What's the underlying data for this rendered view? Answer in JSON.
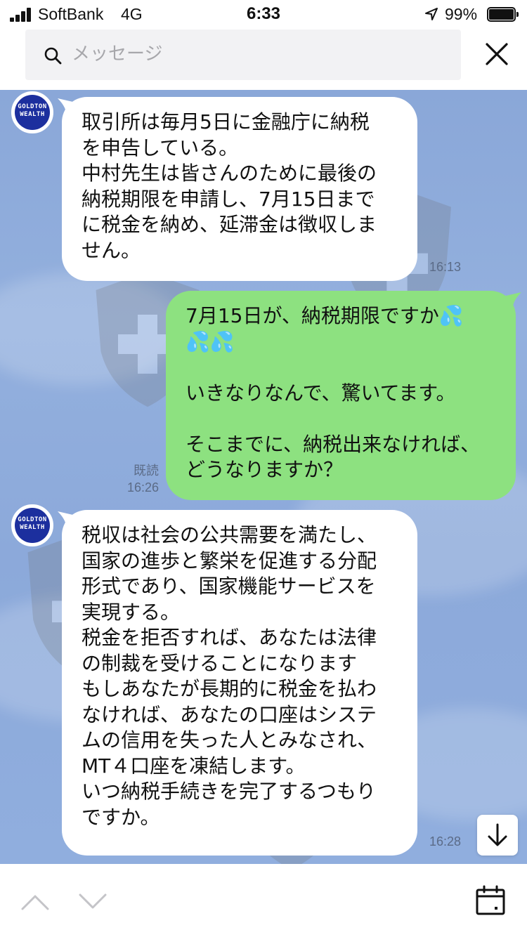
{
  "status_bar": {
    "carrier": "SoftBank",
    "network": "4G",
    "time": "6:33",
    "battery": "99%",
    "icons": [
      "signal-bars-icon",
      "location-arrow-icon",
      "battery-icon"
    ]
  },
  "search": {
    "placeholder": "メッセージ",
    "icon": "search-icon",
    "close_icon": "close-icon"
  },
  "messages": [
    {
      "direction": "received",
      "sender_avatar_text": "GOLDTON WEALTH",
      "text": "取引所は毎月5日に金融庁に納税\nを申告している。\n中村先生は皆さんのために最後の\n納税期限を申請し、7月15日まで\nに税金を納め、延滞金は徴収しま\nせん。",
      "time": "16:13"
    },
    {
      "direction": "sent",
      "text": "7月15日が、納税期限ですか💦\n💦💦\n\nいきなりなんで、驚いてます。\n\nそこまでに、納税出来なければ、\nどうなりますか？",
      "read_label": "既読",
      "time": "16:26"
    },
    {
      "direction": "received",
      "sender_avatar_text": "GOLDTON WEALTH",
      "text": "税収は社会の公共需要を満たし、\n国家の進歩と繁栄を促進する分配\n形式であり、国家機能サービスを\n実現する。\n税金を拒否すれば、あなたは法律\nの制裁を受けることになります\nもしあなたが長期的に税金を払わ\nなければ、あなたの口座はシステ\nムの信用を失った人とみなされ、\nMT４口座を凍結します。\nいつ納税手続きを完了するつもり\nですか。",
      "time": "16:28"
    }
  ],
  "toolbar": {
    "up_icon": "chevron-up-icon",
    "down_icon": "chevron-down-icon",
    "calendar_icon": "calendar-icon",
    "scroll_down_icon": "arrow-down-icon"
  },
  "colors": {
    "chat_background": "#8ca9da",
    "sent_bubble": "#8de180",
    "received_bubble": "#ffffff",
    "avatar": "#1c2f9e"
  }
}
